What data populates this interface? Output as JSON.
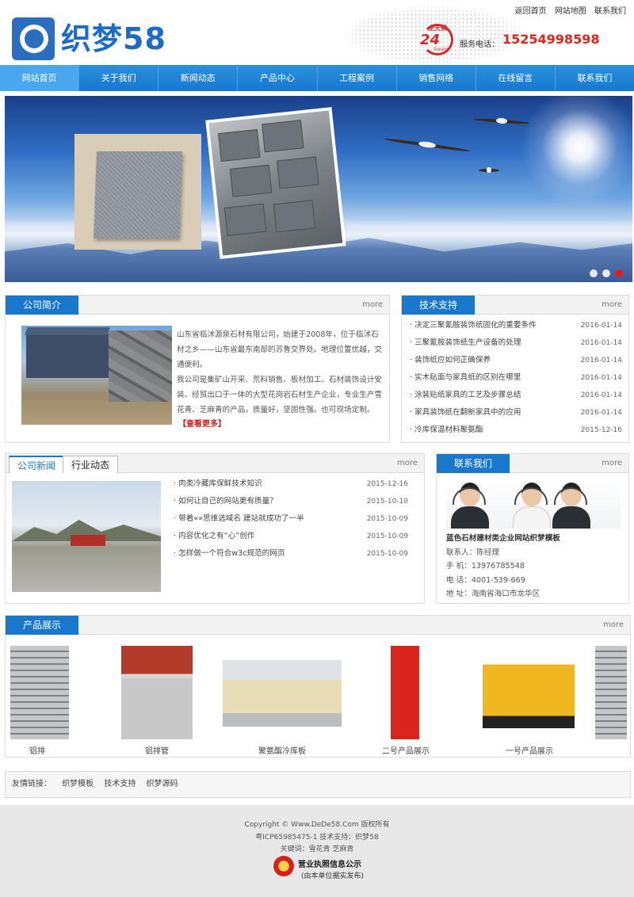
{
  "toplinks": [
    "返回首页",
    "网站地图",
    "联系我们"
  ],
  "logo": {
    "text": "织梦58"
  },
  "hotline": {
    "badge_top": "全天候",
    "badge_num": "24",
    "badge_hours": "hours",
    "label": "服务电话：",
    "number": "15254998598"
  },
  "nav": [
    {
      "label": "网站首页",
      "active": true
    },
    {
      "label": "关于我们"
    },
    {
      "label": "新闻动态"
    },
    {
      "label": "产品中心"
    },
    {
      "label": "工程案例"
    },
    {
      "label": "销售网络"
    },
    {
      "label": "在线留言"
    },
    {
      "label": "联系我们"
    }
  ],
  "banner": {
    "slides": 3,
    "active_slide": 3
  },
  "intro": {
    "title": "公司简介",
    "more": "more",
    "p1": "山东省临沭源泉石材有限公司，始建于2008年，位于临沭石材之乡——山东省最东南部的苏鲁交界处。地理位置优越，交通便利。",
    "p2": "我公司是集矿山开采、荒料销售、板材加工、石材装饰设计安装、经贸出口于一体的大型花岗岩石材生产企业，专业生产雪花青、芝麻青的产品，质量好，坚固性强。也可现场定制。",
    "readmore": "【查看更多】"
  },
  "tech": {
    "title": "技术支持",
    "more": "more",
    "items": [
      {
        "title": "决定三聚氰胺装饰纸固化的重要条件",
        "date": "2016-01-14"
      },
      {
        "title": "三聚氰胺装饰纸生产设备的处理",
        "date": "2016-01-14"
      },
      {
        "title": "装饰纸应如何正确保养",
        "date": "2016-01-14"
      },
      {
        "title": "实木贴面与家具纸的区别在哪里",
        "date": "2016-01-14"
      },
      {
        "title": "涂装贴纸家具的工艺及步骤总结",
        "date": "2016-01-14"
      },
      {
        "title": "家具装饰纸在翻新家具中的应用",
        "date": "2016-01-14"
      },
      {
        "title": "冷库保温材料聚氨酯",
        "date": "2015-12-16"
      }
    ]
  },
  "news": {
    "tabs": [
      "公司新闻",
      "行业动态"
    ],
    "more": "more",
    "items": [
      {
        "title": "肉类冷藏库保鲜技术知识",
        "date": "2015-12-16"
      },
      {
        "title": "如何让自己的网站更有质量？",
        "date": "2015-10-10"
      },
      {
        "title": "带着«»思维选域名 建站就成功了一半",
        "date": "2015-10-09"
      },
      {
        "title": "内容优化之有“心”创作",
        "date": "2015-10-09"
      },
      {
        "title": "怎样做一个符合w3c规范的网页",
        "date": "2015-10-09"
      }
    ]
  },
  "contact": {
    "title": "联系我们",
    "more": "more",
    "company": "蓝色石材建材类企业网站织梦模板",
    "person": "联系人：陈经理",
    "mobile": "手  机：13976785548",
    "tel": "电  话：4001-539-669",
    "address": "地  址：海南省海口市龙华区"
  },
  "products": {
    "title": "产品展示",
    "more": "more",
    "items": [
      {
        "name": "铝排"
      },
      {
        "name": "铝排管"
      },
      {
        "name": "聚氨酯冷库板"
      },
      {
        "name": "二号产品展示"
      },
      {
        "name": "一号产品展示"
      }
    ]
  },
  "friends": {
    "label": "友情链接：",
    "links": [
      "织梦模板",
      "技术支持",
      "织梦源码"
    ]
  },
  "footer": {
    "copyright": "Copyright © Www.DeDe58.Com 版权所有",
    "icp": "粤ICP65985475-1 技术支持：织梦58",
    "keywords": "关键词：雪花青 芝麻青",
    "license": "营业执照信息公示",
    "license_sub": "(由本单位据实发布)"
  },
  "colors": {
    "primary": "#1a78cc",
    "accent_red": "#e2231a",
    "nav_active": "#4aa6ee"
  }
}
